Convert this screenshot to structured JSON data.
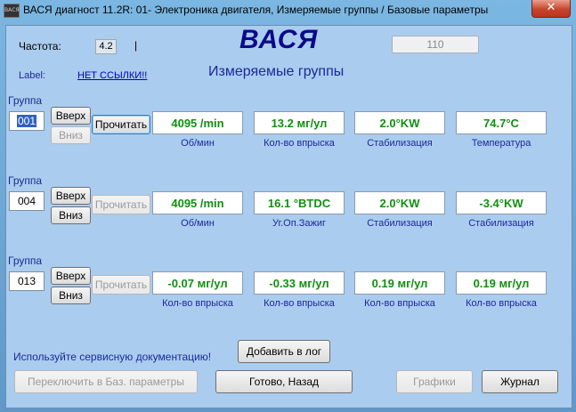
{
  "window": {
    "title": "ВАСЯ диагност 11.2R: 01- Электроника двигателя,  Измеряемые группы / Базовые параметры",
    "icon_text": "ВАСЯ",
    "close_label": "✕"
  },
  "header": {
    "freq_label": "Частота:",
    "freq_value": "4.2",
    "freq_mark": "|",
    "logo": "ВАСЯ",
    "box_value": "110",
    "label_label": "Label:",
    "label_link": "НЕТ ССЫЛКИ!!",
    "heading": "Измеряемые группы"
  },
  "groups": [
    {
      "label": "Группа",
      "number": "001",
      "up": "Вверх",
      "down": "Вниз",
      "read": "Прочитать",
      "values": [
        "4095 /min",
        "13.2 мг/ул",
        "2.0°KW",
        "74.7°C"
      ],
      "captions": [
        "Об/мин",
        "Кол-во впрыска",
        "Стабилизация",
        "Температура"
      ]
    },
    {
      "label": "Группа",
      "number": "004",
      "up": "Вверх",
      "down": "Вниз",
      "read": "Прочитать",
      "values": [
        "4095 /min",
        "16.1 °BTDC",
        "2.0°KW",
        "-3.4°KW"
      ],
      "captions": [
        "Об/мин",
        "Уг.Оп.Зажиг",
        "Стабилизация",
        "Стабилизация"
      ]
    },
    {
      "label": "Группа",
      "number": "013",
      "up": "Вверх",
      "down": "Вниз",
      "read": "Прочитать",
      "values": [
        "-0.07 мг/ул",
        "-0.33 мг/ул",
        "0.19 мг/ул",
        "0.19 мг/ул"
      ],
      "captions": [
        "Кол-во впрыска",
        "Кол-во впрыска",
        "Кол-во впрыска",
        "Кол-во впрыска"
      ]
    }
  ],
  "footer": {
    "hint": "Используйте сервисную документацию!",
    "add_log": "Добавить в лог",
    "switch_basic": "Переключить в Баз. параметры",
    "done_back": "Готово, Назад",
    "graphs": "Графики",
    "journal": "Журнал"
  },
  "colors": {
    "value_green": "#109010",
    "caption_blue": "#1a2a9a",
    "panel": "#aaccee"
  }
}
